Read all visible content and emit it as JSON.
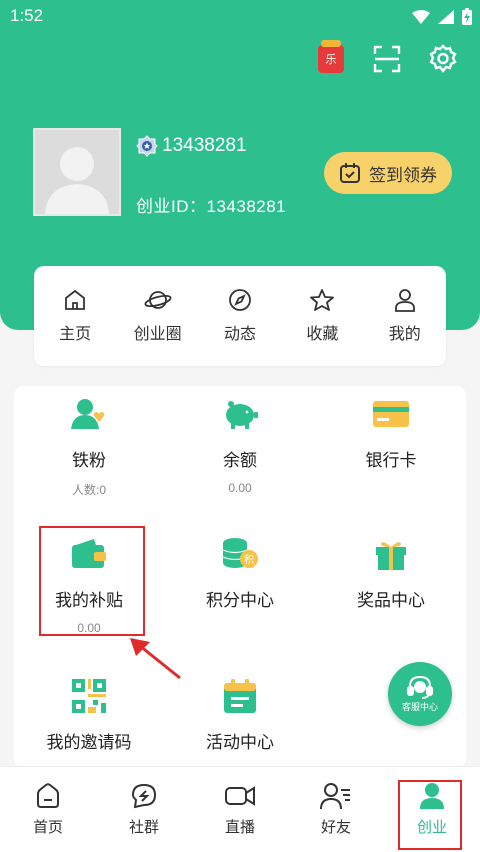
{
  "status": {
    "time": "1:52"
  },
  "profile": {
    "phone": "13438281",
    "id_line": "创业ID：13438281"
  },
  "checkin": {
    "label": "签到领券"
  },
  "lebox_text": "乐",
  "quicknav": [
    {
      "label": "主页",
      "icon": "home-icon"
    },
    {
      "label": "创业圈",
      "icon": "planet-icon"
    },
    {
      "label": "动态",
      "icon": "compass-icon"
    },
    {
      "label": "收藏",
      "icon": "star-icon"
    },
    {
      "label": "我的",
      "icon": "person-icon"
    }
  ],
  "grid": [
    {
      "title": "铁粉",
      "sub": "人数:0",
      "icon": "fans-icon"
    },
    {
      "title": "余额",
      "sub": "0.00",
      "icon": "piggy-bank-icon"
    },
    {
      "title": "银行卡",
      "sub": "",
      "icon": "bank-card-icon"
    },
    {
      "title": "我的补贴",
      "sub": "0.00",
      "icon": "wallet-icon"
    },
    {
      "title": "积分中心",
      "sub": "",
      "icon": "coins-icon"
    },
    {
      "title": "奖品中心",
      "sub": "",
      "icon": "gift-icon"
    },
    {
      "title": "我的邀请码",
      "sub": "",
      "icon": "qrcode-icon"
    },
    {
      "title": "活动中心",
      "sub": "",
      "icon": "calendar-icon"
    }
  ],
  "service": {
    "label": "客服中心"
  },
  "tabs": [
    {
      "label": "首页",
      "icon": "home-tab-icon"
    },
    {
      "label": "社群",
      "icon": "chat-icon"
    },
    {
      "label": "直播",
      "icon": "video-icon"
    },
    {
      "label": "好友",
      "icon": "friends-icon"
    },
    {
      "label": "创业",
      "icon": "user-icon",
      "active": true
    }
  ],
  "colors": {
    "primary": "#2dc08e",
    "accent": "#f7d26a",
    "highlight": "#e02b2b"
  }
}
